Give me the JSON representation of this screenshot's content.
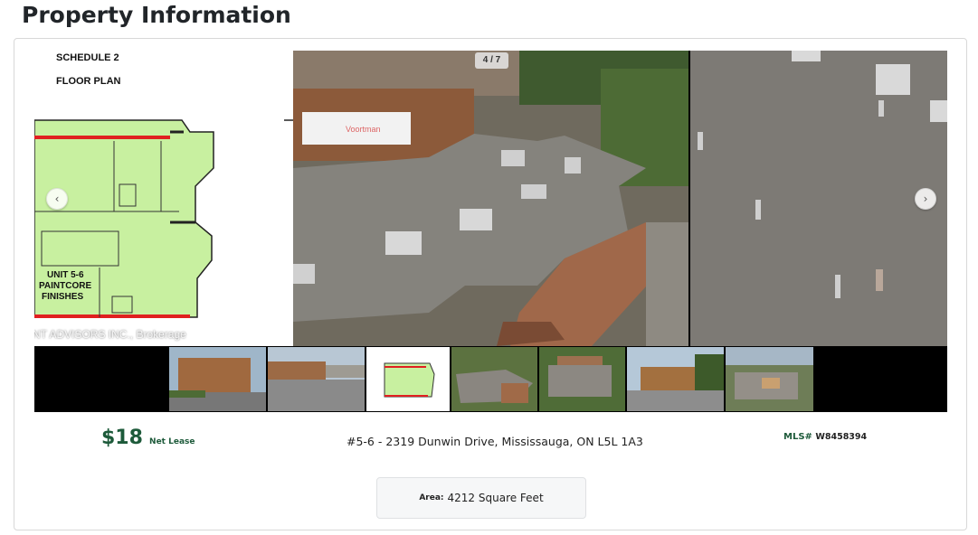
{
  "page": {
    "title": "Property Information"
  },
  "gallery": {
    "counter": "4 / 7",
    "prev_icon": "chevron-left-icon",
    "next_icon": "chevron-right-icon",
    "floor_plan": {
      "heading1": "SCHEDULE 2",
      "heading2": "FLOOR PLAN",
      "unit_line1": "UNIT 5-6",
      "unit_line2": "PAINTCORE",
      "unit_line3": "FINISHES",
      "watermark": "NT ADVISORS INC., Brokerage",
      "wall_accent": "#e02020",
      "fill": "#c8f0a0"
    },
    "main_image_truck_text": "Voortman",
    "thumbnails": [
      "building-exterior",
      "parking-lot",
      "floor-plan",
      "aerial-roof",
      "aerial-lot",
      "building-front",
      "aerial-view"
    ]
  },
  "listing": {
    "price": "$18",
    "lease_type": "Net Lease",
    "address": "#5-6 - 2319 Dunwin Drive, Mississauga, ON L5L 1A3",
    "mls_label": "MLS#",
    "mls_number": "W8458394",
    "area_label": "Area:",
    "area_value": "4212 Square Feet"
  },
  "colors": {
    "accent_green": "#1d5a3a"
  }
}
